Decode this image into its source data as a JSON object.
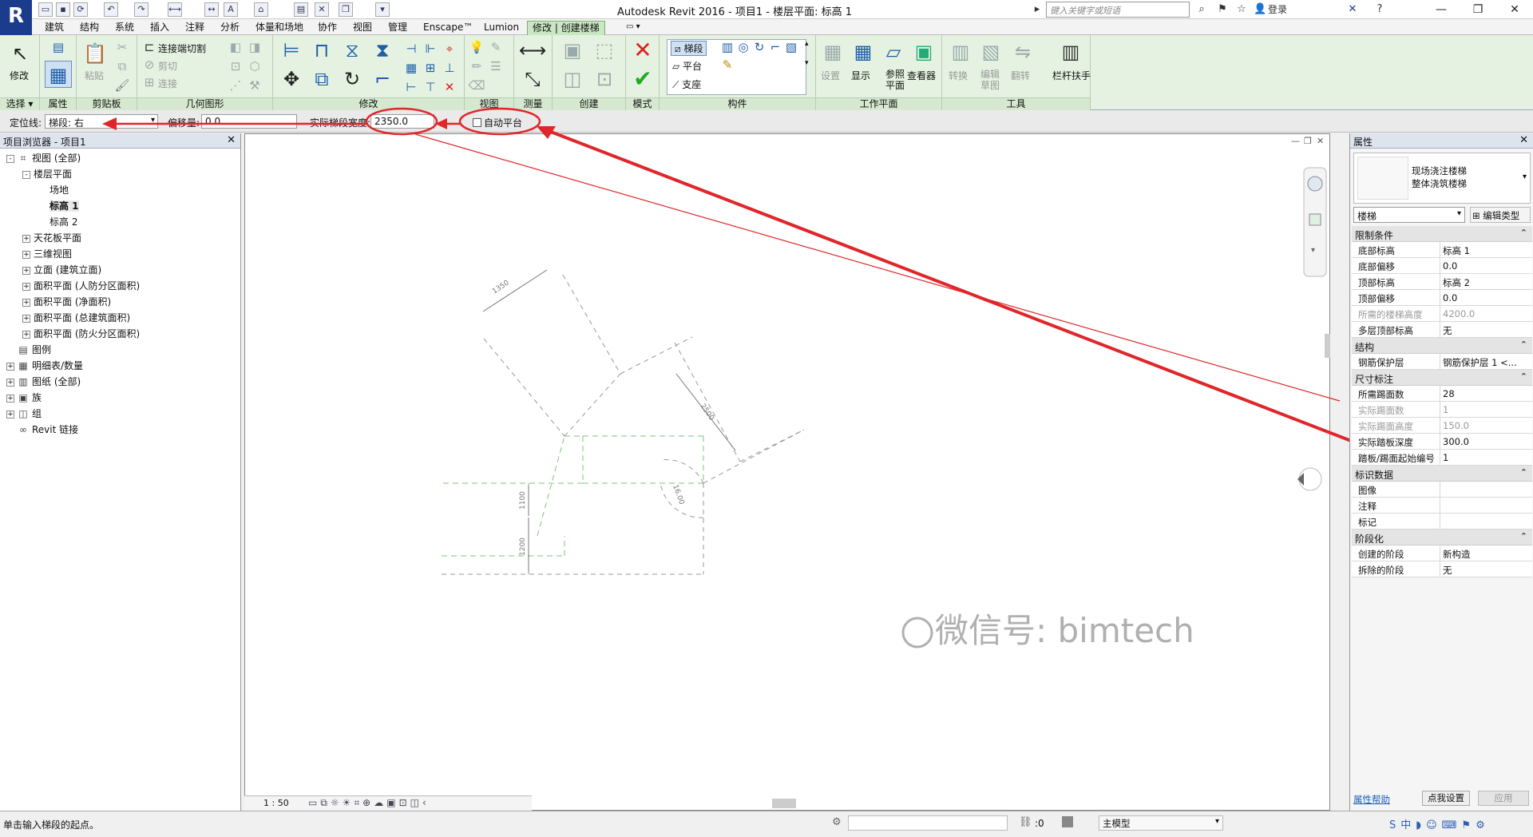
{
  "app": {
    "logo": "R",
    "title": "Autodesk Revit 2016 -    项目1 - 楼层平面: 标高 1",
    "search_placeholder": "键入关键字或短语",
    "login": "登录"
  },
  "tabs": [
    "建筑",
    "结构",
    "系统",
    "插入",
    "注释",
    "分析",
    "体量和场地",
    "协作",
    "视图",
    "管理",
    "Enscape™",
    "Lumion",
    "修改 | 创建楼梯"
  ],
  "ribbon": {
    "select_label": "选择",
    "modify_label": "修改",
    "properties_label": "属性",
    "clipboard_label": "剪贴板",
    "paste_label": "粘贴",
    "geometry_label": "几何图形",
    "join_label": "连接端切割",
    "cut_label": "剪切",
    "join2_label": "连接",
    "modify_panel_label": "修改",
    "view_label": "视图",
    "measure_label": "测量",
    "create_label": "创建",
    "mode_label": "模式",
    "component_label": "构件",
    "run_label": "梯段",
    "landing_label": "平台",
    "support_label": "支座",
    "workplane_label": "工作平面",
    "set_label": "设置",
    "show_label": "显示",
    "ref_plane_label": "参照平面",
    "viewer_label": "查看器",
    "tools_label": "工具",
    "convert_label": "转换",
    "edit_sketch_label": "编辑草图",
    "flip_label": "翻转",
    "railing_label": "栏杆扶手"
  },
  "options_bar": {
    "location_line_label": "定位线:",
    "location_line_value": "梯段: 右",
    "offset_label": "偏移量:",
    "offset_value": "0.0",
    "run_width_label": "实际梯段宽度:",
    "run_width_value": "2350.0",
    "auto_landing_label": "自动平台"
  },
  "browser": {
    "title": "项目浏览器 - 项目1",
    "items": [
      {
        "text": "视图 (全部)",
        "level": 0,
        "toggle": "-",
        "icon": "⌗"
      },
      {
        "text": "楼层平面",
        "level": 1,
        "toggle": "-",
        "icon": ""
      },
      {
        "text": "场地",
        "level": 2,
        "toggle": "",
        "icon": ""
      },
      {
        "text": "标高 1",
        "level": 2,
        "toggle": "",
        "icon": "",
        "selected": true
      },
      {
        "text": "标高 2",
        "level": 2,
        "toggle": "",
        "icon": ""
      },
      {
        "text": "天花板平面",
        "level": 1,
        "toggle": "+",
        "icon": ""
      },
      {
        "text": "三维视图",
        "level": 1,
        "toggle": "+",
        "icon": ""
      },
      {
        "text": "立面 (建筑立面)",
        "level": 1,
        "toggle": "+",
        "icon": ""
      },
      {
        "text": "面积平面 (人防分区面积)",
        "level": 1,
        "toggle": "+",
        "icon": ""
      },
      {
        "text": "面积平面 (净面积)",
        "level": 1,
        "toggle": "+",
        "icon": ""
      },
      {
        "text": "面积平面 (总建筑面积)",
        "level": 1,
        "toggle": "+",
        "icon": ""
      },
      {
        "text": "面积平面 (防火分区面积)",
        "level": 1,
        "toggle": "+",
        "icon": ""
      },
      {
        "text": "图例",
        "level": 0,
        "toggle": "",
        "icon": "▤"
      },
      {
        "text": "明细表/数量",
        "level": 0,
        "toggle": "+",
        "icon": "▦"
      },
      {
        "text": "图纸 (全部)",
        "level": 0,
        "toggle": "+",
        "icon": "▥"
      },
      {
        "text": "族",
        "level": 0,
        "toggle": "+",
        "icon": "▣"
      },
      {
        "text": "组",
        "level": 0,
        "toggle": "+",
        "icon": "◫"
      },
      {
        "text": "Revit 链接",
        "level": 0,
        "toggle": "",
        "icon": "∞"
      }
    ]
  },
  "canvas": {
    "dims": [
      "1350",
      "2500",
      "1100",
      "1200",
      "16.00"
    ],
    "view_scale": "1 : 50"
  },
  "properties": {
    "title": "属性",
    "type_name_1": "现场浇注楼梯",
    "type_name_2": "整体浇筑楼梯",
    "category": "楼梯",
    "edit_type": "编辑类型",
    "groups": [
      {
        "name": "限制条件",
        "rows": [
          {
            "k": "底部标高",
            "v": "标高 1"
          },
          {
            "k": "底部偏移",
            "v": "0.0"
          },
          {
            "k": "顶部标高",
            "v": "标高 2"
          },
          {
            "k": "顶部偏移",
            "v": "0.0"
          },
          {
            "k": "所需的楼梯高度",
            "v": "4200.0",
            "dim": true
          },
          {
            "k": "多层顶部标高",
            "v": "无"
          }
        ]
      },
      {
        "name": "结构",
        "rows": [
          {
            "k": "钢筋保护层",
            "v": "钢筋保护层 1 <..."
          }
        ]
      },
      {
        "name": "尺寸标注",
        "rows": [
          {
            "k": "所需踢面数",
            "v": "28"
          },
          {
            "k": "实际踢面数",
            "v": "1",
            "dim": true
          },
          {
            "k": "实际踢面高度",
            "v": "150.0",
            "dim": true
          },
          {
            "k": "实际踏板深度",
            "v": "300.0"
          },
          {
            "k": "踏板/踢面起始编号",
            "v": "1"
          }
        ]
      },
      {
        "name": "标识数据",
        "rows": [
          {
            "k": "图像",
            "v": ""
          },
          {
            "k": "注释",
            "v": ""
          },
          {
            "k": "标记",
            "v": ""
          }
        ]
      },
      {
        "name": "阶段化",
        "rows": [
          {
            "k": "创建的阶段",
            "v": "新构造"
          },
          {
            "k": "拆除的阶段",
            "v": "无"
          }
        ]
      }
    ],
    "help_link": "属性帮助",
    "apply": "应用"
  },
  "watermark": "微信号: bimtech",
  "status": {
    "prompt": "单击输入梯段的起点。",
    "coord": ":0",
    "model": "主模型"
  },
  "colors": {
    "annotation_red": "#e0262b",
    "ribbon_green": "#e5f2e1",
    "dashed_green": "#7bc47b"
  }
}
